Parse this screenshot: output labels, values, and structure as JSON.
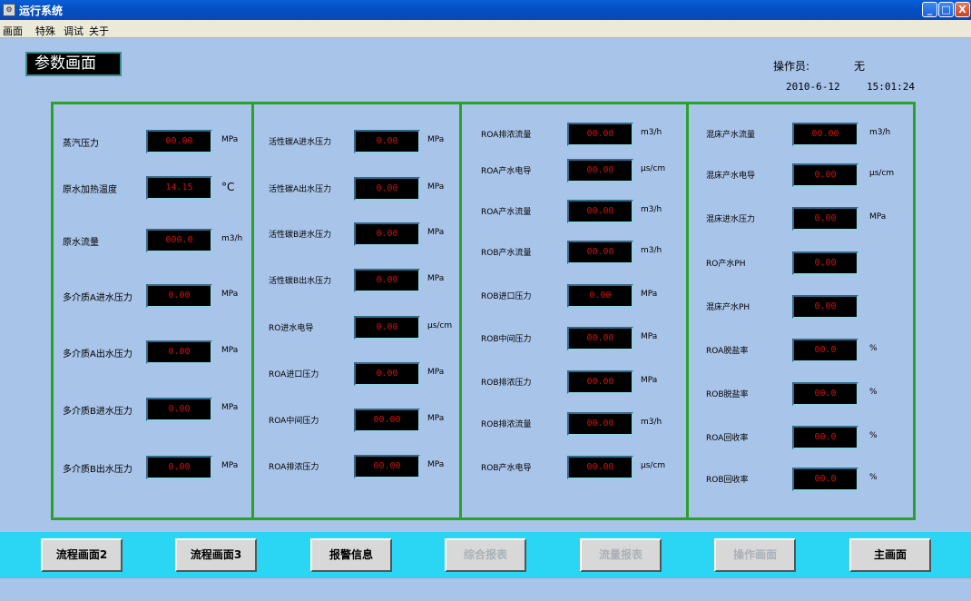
{
  "window": {
    "title": "运行系统",
    "icon": "app-icon",
    "min": "_",
    "max": "□",
    "close": "X"
  },
  "menu": [
    "画面",
    "特殊",
    "调试",
    "关于"
  ],
  "page_title": "参数画面",
  "operator": {
    "label": "操作员:",
    "value": "无"
  },
  "date": "2010-6-12",
  "time": "15:01:24",
  "panels": [
    {
      "rows": [
        {
          "label": "蒸汽压力",
          "value": "00.00",
          "unit": "MPa"
        },
        {
          "label": "原水加热温度",
          "value": "14.15",
          "unit": "°C"
        },
        {
          "label": "原水流量",
          "value": "000.0",
          "unit": "m3/h"
        },
        {
          "label": "多介质A进水压力",
          "value": "0.00",
          "unit": "MPa"
        },
        {
          "label": "多介质A出水压力",
          "value": "0.00",
          "unit": "MPa"
        },
        {
          "label": "多介质B进水压力",
          "value": "0.00",
          "unit": "MPa"
        },
        {
          "label": "多介质B出水压力",
          "value": "0.00",
          "unit": "MPa"
        }
      ]
    },
    {
      "rows": [
        {
          "label": "活性碳A进水压力",
          "value": "0.00",
          "unit": "MPa"
        },
        {
          "label": "活性碳A出水压力",
          "value": "0.00",
          "unit": "MPa"
        },
        {
          "label": "活性碳B进水压力",
          "value": "0.00",
          "unit": "MPa"
        },
        {
          "label": "活性碳B出水压力",
          "value": "0.00",
          "unit": "MPa"
        },
        {
          "label": "RO进水电导",
          "value": "0.00",
          "unit": "μs/cm"
        },
        {
          "label": "ROA进口压力",
          "value": "0.00",
          "unit": "MPa"
        },
        {
          "label": "ROA中间压力",
          "value": "00.00",
          "unit": "MPa"
        },
        {
          "label": "ROA排浓压力",
          "value": "00.00",
          "unit": "MPa"
        }
      ]
    },
    {
      "rows": [
        {
          "label": "ROA排浓流量",
          "value": "00.00",
          "unit": "m3/h"
        },
        {
          "label": "ROA产水电导",
          "value": "00.00",
          "unit": "μs/cm"
        },
        {
          "label": "ROA产水流量",
          "value": "00.00",
          "unit": "m3/h"
        },
        {
          "label": "ROB产水流量",
          "value": "00.00",
          "unit": "m3/h"
        },
        {
          "label": "ROB进口压力",
          "value": "0.00",
          "unit": "MPa"
        },
        {
          "label": "ROB中间压力",
          "value": "00.00",
          "unit": "MPa"
        },
        {
          "label": "ROB排浓压力",
          "value": "00.00",
          "unit": "MPa"
        },
        {
          "label": "ROB排浓流量",
          "value": "00.00",
          "unit": "m3/h"
        },
        {
          "label": "ROB产水电导",
          "value": "00.00",
          "unit": "μs/cm"
        }
      ]
    },
    {
      "rows": [
        {
          "label": "混床产水流量",
          "value": "00.00",
          "unit": "m3/h"
        },
        {
          "label": "混床产水电导",
          "value": "0.00",
          "unit": "μs/cm"
        },
        {
          "label": "混床进水压力",
          "value": "0.00",
          "unit": "MPa"
        },
        {
          "label": "RO产水PH",
          "value": "0.00",
          "unit": ""
        },
        {
          "label": "混床产水PH",
          "value": "0.00",
          "unit": ""
        },
        {
          "label": "ROA脱盐率",
          "value": "00.0",
          "unit": "%"
        },
        {
          "label": "ROB脱盐率",
          "value": "00.0",
          "unit": "%"
        },
        {
          "label": "ROA回收率",
          "value": "00.0",
          "unit": "%"
        },
        {
          "label": "ROB回收率",
          "value": "00.0",
          "unit": "%"
        }
      ]
    }
  ],
  "buttons": [
    {
      "label": "流程画面2",
      "enabled": true
    },
    {
      "label": "流程画面3",
      "enabled": true
    },
    {
      "label": "报警信息",
      "enabled": true
    },
    {
      "label": "综合报表",
      "enabled": false
    },
    {
      "label": "流量报表",
      "enabled": false
    },
    {
      "label": "操作画面",
      "enabled": false
    },
    {
      "label": "主画面",
      "enabled": true
    }
  ],
  "colors": {
    "accent_green": "#2aa12a",
    "value_red": "#d21010",
    "background": "#a9c4e9",
    "bottom_bar": "#2ad6f4"
  }
}
